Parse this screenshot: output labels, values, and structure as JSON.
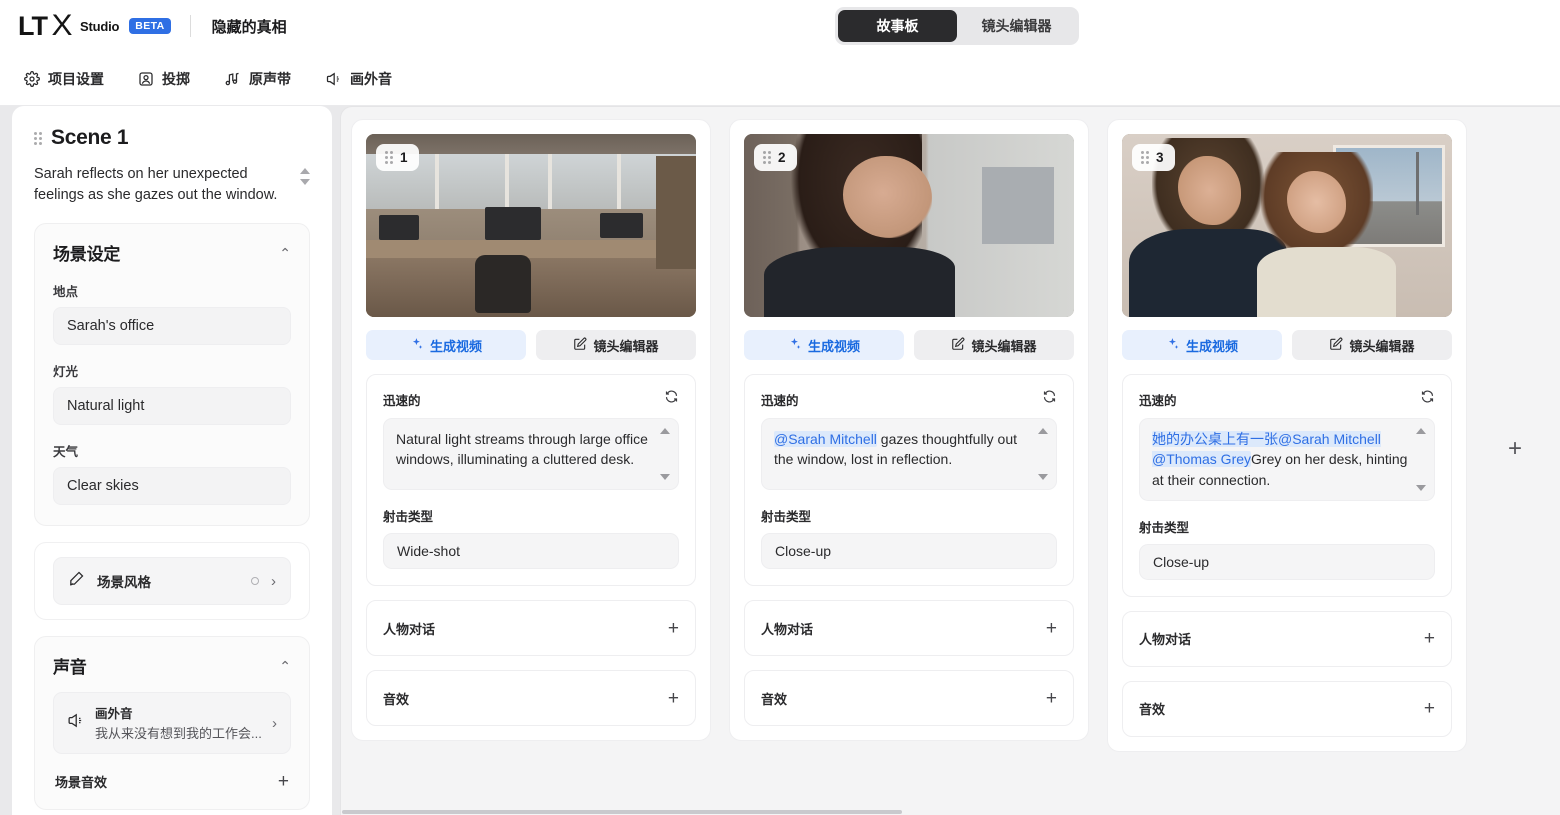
{
  "brand": {
    "logo_lt": "LT",
    "logo_x": "X",
    "logo_studio": "Studio",
    "beta": "BETA",
    "project_title": "隐藏的真相"
  },
  "segmented": {
    "tabs": [
      {
        "label": "故事板",
        "active": true
      },
      {
        "label": "镜头编辑器",
        "active": false
      }
    ]
  },
  "toolbar": {
    "items": [
      {
        "icon": "gear-icon",
        "label": "项目设置"
      },
      {
        "icon": "cast-icon",
        "label": "投掷"
      },
      {
        "icon": "music-note-icon",
        "label": "原声带"
      },
      {
        "icon": "megaphone-icon",
        "label": "画外音"
      }
    ]
  },
  "sidebar": {
    "scene_title": "Scene 1",
    "scene_description": "Sarah reflects on her unexpected feelings as she gazes out the window.",
    "scene_setup": {
      "title": "场景设定",
      "fields": [
        {
          "label": "地点",
          "value": "Sarah's office"
        },
        {
          "label": "灯光",
          "value": "Natural light"
        },
        {
          "label": "天气",
          "value": "Clear skies"
        }
      ]
    },
    "scene_style": {
      "label": "场景风格"
    },
    "sound": {
      "title": "声音",
      "voiceover_label": "画外音",
      "voiceover_text": "我从来没有想到我的工作会...",
      "scene_sfx_label": "场景音效",
      "add_symbol": "+"
    }
  },
  "board": {
    "add_shot_symbol": "+",
    "shots": [
      {
        "number": "1",
        "thumb": "office-wide-shot-thumbnail",
        "generate_label": "生成视频",
        "editor_label": "镜头编辑器",
        "prompt_label": "迅速的",
        "prompt_segments": [
          {
            "text": "Natural light streams through large office windows, illuminating a cluttered desk.",
            "mention": false
          }
        ],
        "shot_type_label": "射击类型",
        "shot_type_value": "Wide-shot",
        "dialogue_label": "人物对话",
        "sfx_label": "音效",
        "add_symbol": "+"
      },
      {
        "number": "2",
        "thumb": "woman-closeup-window-thumbnail",
        "generate_label": "生成视频",
        "editor_label": "镜头编辑器",
        "prompt_label": "迅速的",
        "prompt_segments": [
          {
            "text": "@Sarah Mitchell",
            "mention": true
          },
          {
            "text": " gazes thoughtfully out the window, lost in reflection.",
            "mention": false
          }
        ],
        "shot_type_label": "射击类型",
        "shot_type_value": "Close-up",
        "dialogue_label": "人物对话",
        "sfx_label": "音效",
        "add_symbol": "+"
      },
      {
        "number": "3",
        "thumb": "couple-portrait-thumbnail",
        "generate_label": "生成视频",
        "editor_label": "镜头编辑器",
        "prompt_label": "迅速的",
        "prompt_segments": [
          {
            "text": "她的办公桌上有一张@Sarah Mitchell @Thomas Grey",
            "mention": true
          },
          {
            "text": "Grey on her desk, hinting at their connection.",
            "mention": false
          }
        ],
        "shot_type_label": "射击类型",
        "shot_type_value": "Close-up",
        "dialogue_label": "人物对话",
        "sfx_label": "音效",
        "add_symbol": "+"
      }
    ]
  },
  "colors": {
    "accent_blue": "#2f6fe4",
    "generate_bg": "#e8f0fd",
    "active_tab_bg": "#2b2b2d",
    "workspace_bg": "#e9e9eb",
    "board_bg": "#f4f4f5"
  }
}
